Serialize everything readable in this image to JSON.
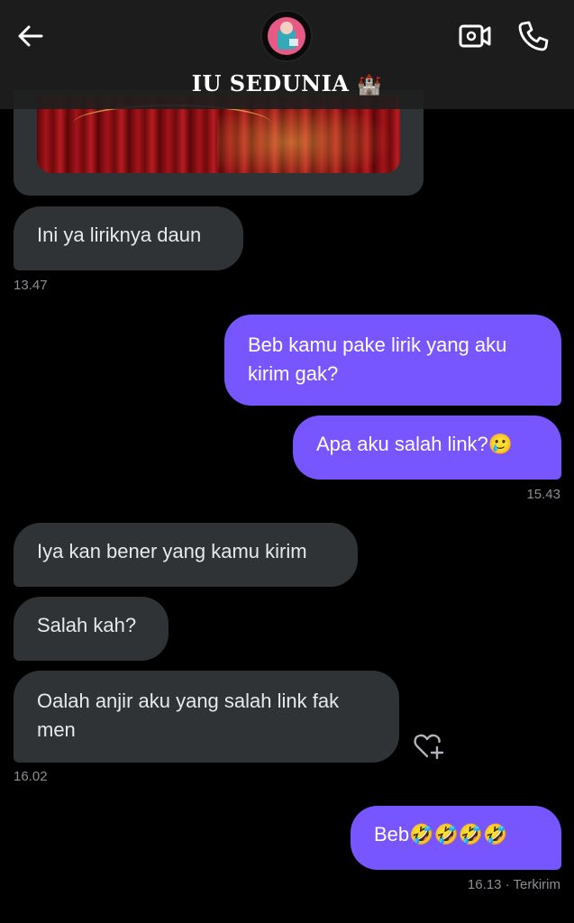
{
  "header": {
    "title": "IU SEDUNIA",
    "title_emoji": "🏰",
    "icons": {
      "back": "arrow-left-icon",
      "video": "video-camera-icon",
      "call": "phone-icon"
    }
  },
  "colors": {
    "outgoing_bubble": "#7856ff",
    "incoming_bubble": "#2f3336",
    "background": "#000000",
    "timestamp": "#8b8f94"
  },
  "messages": [
    {
      "direction": "in",
      "type": "media",
      "description": "image-attachment"
    },
    {
      "direction": "in",
      "text": "Ini ya liriknya daun"
    },
    {
      "direction": "out",
      "text": "Beb kamu pake lirik yang aku kirim gak?"
    },
    {
      "direction": "out",
      "text": "Apa aku salah link?🥲"
    },
    {
      "direction": "in",
      "text": "Iya kan bener yang kamu kirim"
    },
    {
      "direction": "in",
      "text": "Salah kah?"
    },
    {
      "direction": "in",
      "text": "Oalah anjir aku yang salah link fak men"
    },
    {
      "direction": "out",
      "text": "Beb🤣🤣🤣🤣"
    }
  ],
  "timestamps": {
    "t1": "13.47",
    "t2": "15.43",
    "t3": "16.02",
    "t4": "16.13 · Terkirim"
  }
}
